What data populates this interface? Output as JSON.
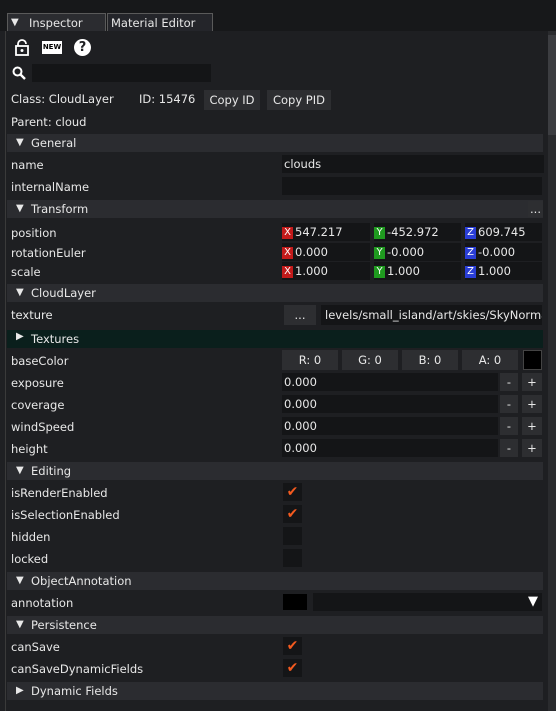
{
  "tabs": [
    "Inspector",
    "Material Editor"
  ],
  "toolbar": {
    "lock_icon": "lock-icon",
    "new_label": "NEW",
    "help_glyph": "?"
  },
  "search": {
    "placeholder": ""
  },
  "info": {
    "class_text": "Class: CloudLayer",
    "id_text": "ID: 15476",
    "copy_id": "Copy ID",
    "copy_pid": "Copy PID",
    "parent_text": "Parent: cloud"
  },
  "general": {
    "title": "General",
    "name_label": "name",
    "name_value": "clouds",
    "internal_label": "internalName",
    "internal_value": ""
  },
  "transform": {
    "title": "Transform",
    "more": "...",
    "position_label": "position",
    "position": {
      "x": "547.217",
      "y": "-452.972",
      "z": "609.745"
    },
    "rotation_label": "rotationEuler",
    "rotation": {
      "x": "0.000",
      "y": "-0.000",
      "z": "-0.000"
    },
    "scale_label": "scale",
    "scale": {
      "x": "1.000",
      "y": "1.000",
      "z": "1.000"
    },
    "axis_x": "X",
    "axis_y": "Y",
    "axis_z": "Z"
  },
  "cloudlayer": {
    "title": "CloudLayer",
    "texture_label": "texture",
    "texture_button": "...",
    "texture_value": "levels/small_island/art/skies/SkyNorma",
    "textures_title": "Textures",
    "basecolor_label": "baseColor",
    "r": "R: 0",
    "g": "G: 0",
    "b": "B: 0",
    "a": "A: 0",
    "exposure_label": "exposure",
    "exposure_value": "0.000",
    "coverage_label": "coverage",
    "coverage_value": "0.000",
    "windspeed_label": "windSpeed",
    "windspeed_value": "0.000",
    "height_label": "height",
    "height_value": "0.000",
    "minus": "-",
    "plus": "+"
  },
  "editing": {
    "title": "Editing",
    "render_label": "isRenderEnabled",
    "render_checked": true,
    "selection_label": "isSelectionEnabled",
    "selection_checked": true,
    "hidden_label": "hidden",
    "hidden_checked": false,
    "locked_label": "locked",
    "locked_checked": false
  },
  "annotation": {
    "title": "ObjectAnnotation",
    "label": "annotation",
    "dropdown_arrow": "▼"
  },
  "persistence": {
    "title": "Persistence",
    "cansave_label": "canSave",
    "cansave_checked": true,
    "dyn_label": "canSaveDynamicFields",
    "dyn_checked": true
  },
  "dynamic": {
    "title": "Dynamic Fields"
  },
  "colors": {
    "accent_check": "#f35a1f",
    "x": "#c21a1a",
    "y": "#1f9a1f",
    "z": "#2a3ed6"
  }
}
